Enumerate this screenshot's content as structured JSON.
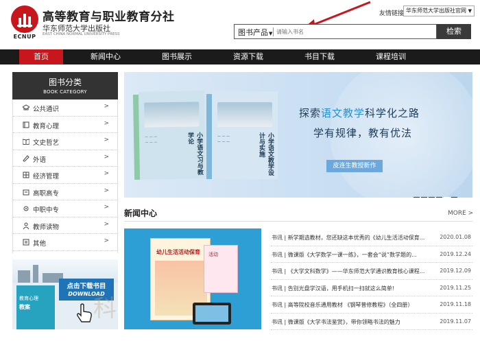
{
  "header": {
    "logo_text": "ECNUP",
    "title": "高等教育与职业教育分社",
    "subtitle": "华东师范大学出版社",
    "subtitle_en": "EAST CHINA NORMAL UNIVERSITY PRESS",
    "friend_link_label": "友情链接:",
    "friend_link_value": "华东师范大学出版社官网",
    "search": {
      "category": "图书产品",
      "placeholder": "请输入书名",
      "button": "检索"
    }
  },
  "nav": {
    "items": [
      {
        "label": "首页",
        "active": true
      },
      {
        "label": "新闻中心"
      },
      {
        "label": "图书展示"
      },
      {
        "label": "资源下载"
      },
      {
        "label": "书目下载"
      },
      {
        "label": "课程培训"
      }
    ]
  },
  "sidebar": {
    "title": "图书分类",
    "title_en": "BOOK CATEGORY",
    "items": [
      {
        "label": "公共通识",
        "icon": "cap-icon"
      },
      {
        "label": "教育心理",
        "icon": "book-icon"
      },
      {
        "label": "文史哲艺",
        "icon": "book-open-icon"
      },
      {
        "label": "外语",
        "icon": "pen-icon"
      },
      {
        "label": "经济管理",
        "icon": "grid-icon"
      },
      {
        "label": "高职高专",
        "icon": "document-icon"
      },
      {
        "label": "中职中专",
        "icon": "gear-icon"
      },
      {
        "label": "教师读物",
        "icon": "person-icon"
      },
      {
        "label": "其他",
        "icon": "list-icon"
      }
    ],
    "arrow": ">",
    "promo": {
      "book_label": "教育心理",
      "book_sub": "教案",
      "download_label": "点击下载书目",
      "download_en": "DOWNLOAD",
      "watermark": "科"
    }
  },
  "banner": {
    "book1_title": "小学语文习与教学论",
    "book2_title": "小学语文教学设计与实施",
    "slogan_part1": "探索",
    "slogan_highlight": "语文教学",
    "slogan_part2": "科学化之路",
    "slogan_line2": "学有规律，教有优法",
    "author_tag": "皮连生教授新作"
  },
  "news": {
    "title": "新闻中心",
    "more": "MORE >",
    "image": {
      "book_title": "幼儿生活活动保育",
      "side_book": "活动"
    },
    "items": [
      {
        "text": "书讯 | 新学期选教材，您还缺这本优秀的《幼儿生活活动保育...",
        "date": "2020.01.08"
      },
      {
        "text": "书讯 | 微课版《大学数学一课一练》，一套会“说”数学题的...",
        "date": "2019.12.24"
      },
      {
        "text": "书讯 | 《大学文科数学》——华东师范大学通识教育核心课程...",
        "date": "2019.12.09"
      },
      {
        "text": "书讯 | 告别光盘学汉语，用手机扫一扫就这么简单!",
        "date": "2019.11.25"
      },
      {
        "text": "书讯 | 高等院校音乐通用教材 《钢琴普修教程》（全四册）",
        "date": "2019.11.18"
      },
      {
        "text": "书讯 | 微课版《大学书法鉴赏》，带你领略书法的魅力",
        "date": "2019.11.07"
      }
    ]
  },
  "colors": {
    "brand_red": "#c8161d",
    "nav_bg": "#1b1b1b",
    "search_button": "#3a3a3a",
    "banner_accent": "#2792d1"
  }
}
